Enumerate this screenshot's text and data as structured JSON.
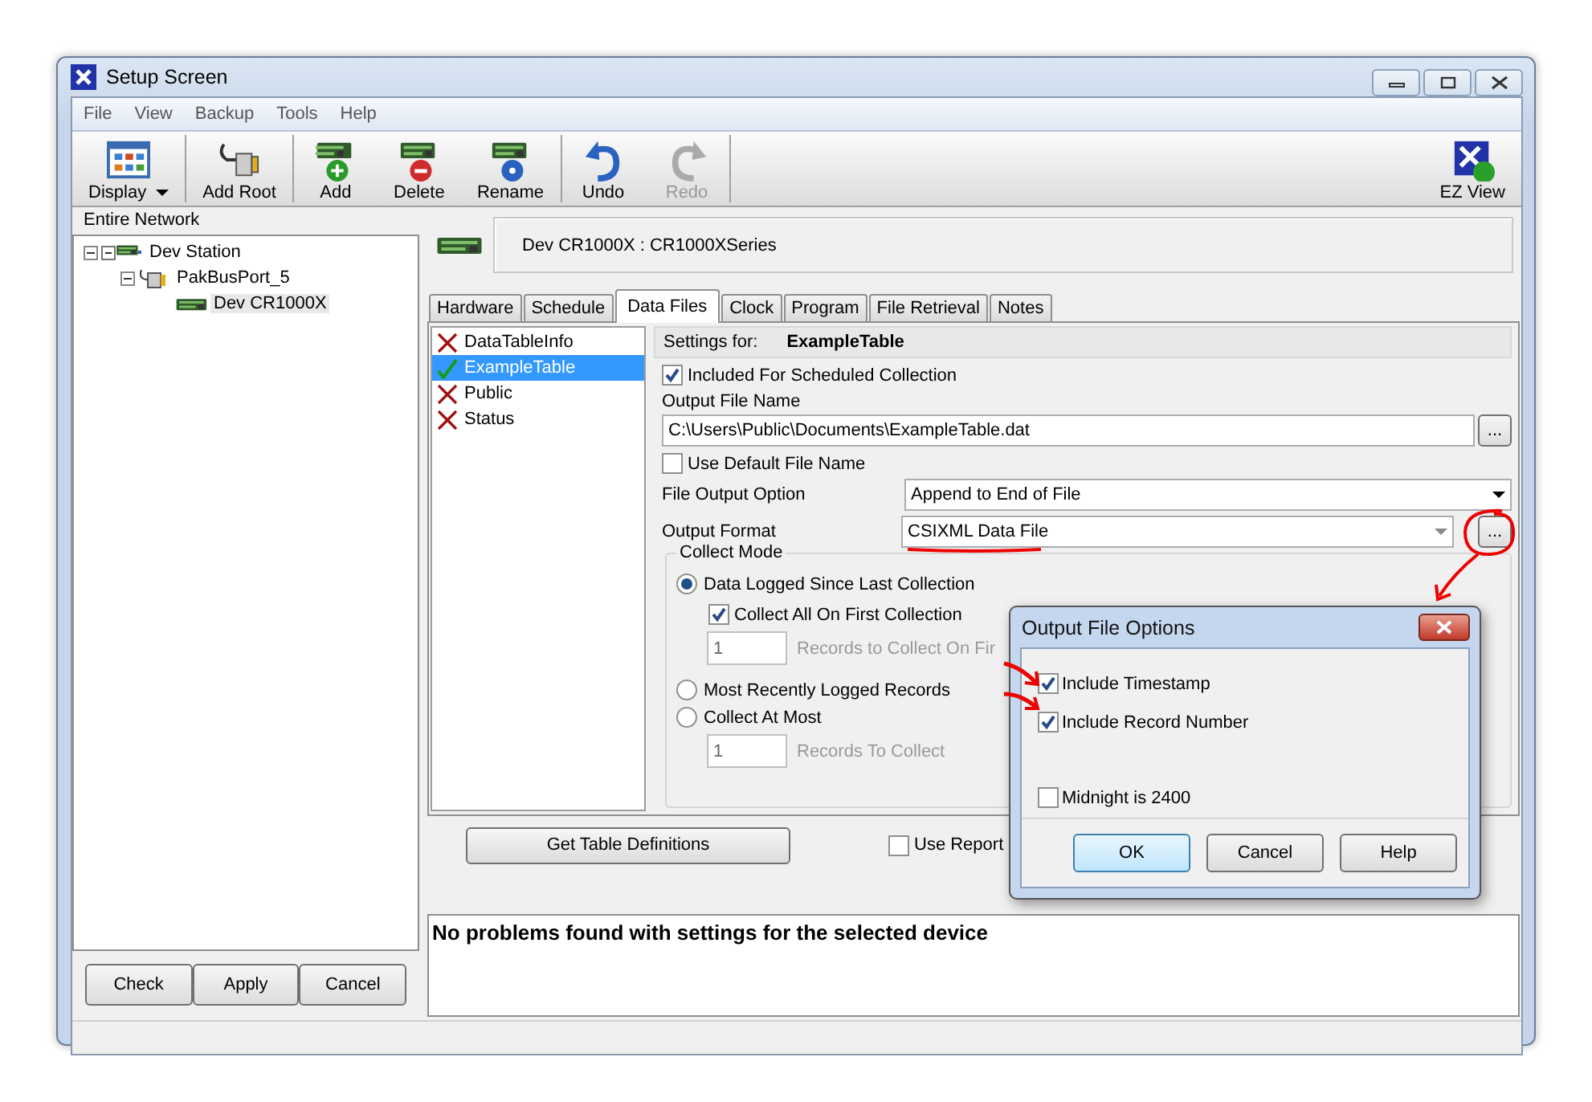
{
  "window": {
    "title": "Setup Screen"
  },
  "menu": [
    {
      "label": "File"
    },
    {
      "label": "View"
    },
    {
      "label": "Backup"
    },
    {
      "label": "Tools"
    },
    {
      "label": "Help"
    }
  ],
  "toolbar": [
    {
      "kind": "display",
      "label": "Display",
      "disabled": false,
      "separator_after": true
    },
    {
      "kind": "add_root",
      "label": "Add Root",
      "disabled": false,
      "separator_after": true
    },
    {
      "kind": "add",
      "label": "Add",
      "disabled": false,
      "separator_after": false
    },
    {
      "kind": "delete",
      "label": "Delete",
      "disabled": false,
      "separator_after": false
    },
    {
      "kind": "rename",
      "label": "Rename",
      "disabled": false,
      "separator_after": true
    },
    {
      "kind": "undo",
      "label": "Undo",
      "disabled": false,
      "separator_after": false
    },
    {
      "kind": "redo",
      "label": "Redo",
      "disabled": true,
      "separator_after": true
    },
    {
      "kind": "ez_view",
      "label": "EZ View",
      "disabled": false,
      "separator_after": false
    }
  ],
  "network": {
    "title": "Entire Network",
    "tree": [
      {
        "label": "Dev Station",
        "kind": "station",
        "expanded": true,
        "selected": false,
        "children": [
          {
            "label": "PakBusPort_5",
            "kind": "port",
            "expanded": true,
            "selected": false,
            "children": [
              {
                "label": "Dev CR1000X",
                "kind": "datalogger",
                "selected": true
              }
            ]
          }
        ]
      }
    ],
    "buttons": [
      {
        "label": "Check"
      },
      {
        "label": "Apply"
      },
      {
        "label": "Cancel"
      }
    ]
  },
  "device": {
    "title": "Dev CR1000X : CR1000XSeries"
  },
  "tabs": [
    {
      "label": "Hardware",
      "selected": false
    },
    {
      "label": "Schedule",
      "selected": false
    },
    {
      "label": "Data Files",
      "selected": true
    },
    {
      "label": "Clock",
      "selected": false
    },
    {
      "label": "Program",
      "selected": false
    },
    {
      "label": "File Retrieval",
      "selected": false
    },
    {
      "label": "Notes",
      "selected": false
    }
  ],
  "tables": [
    {
      "name": "DataTableInfo",
      "included": false,
      "selected": false
    },
    {
      "name": "ExampleTable",
      "included": true,
      "selected": true
    },
    {
      "name": "Public",
      "included": false,
      "selected": false
    },
    {
      "name": "Status",
      "included": false,
      "selected": false
    }
  ],
  "settings": {
    "settings_for_label": "Settings for:",
    "table_name": "ExampleTable",
    "included": {
      "label": "Included For Scheduled Collection",
      "checked": true
    },
    "output_file_name_label": "Output File Name",
    "output_file_name": "C:\\Users\\Public\\Documents\\ExampleTable.dat",
    "browse_button": "...",
    "use_default_name": {
      "label": "Use Default File Name",
      "checked": false
    },
    "file_output_option": {
      "label": "File Output Option",
      "value": "Append to End of File"
    },
    "output_format": {
      "label": "Output Format",
      "value": "CSIXML Data File",
      "button": "..."
    },
    "collect_mode": {
      "title": "Collect Mode",
      "data_logged": {
        "label": "Data Logged Since Last Collection",
        "selected": true
      },
      "collect_all": {
        "label": "Collect All On First Collection",
        "checked": true
      },
      "first_records": {
        "value": "1",
        "label": "Records to Collect On Fir",
        "disabled": true
      },
      "most_recent": {
        "label": "Most Recently Logged Records",
        "selected": false
      },
      "collect_at_most": {
        "label": "Collect At Most",
        "selected": false
      },
      "records_to_collect": {
        "value": "1",
        "label": "Records To Collect",
        "disabled": true
      }
    }
  },
  "get_table_definitions": "Get Table Definitions",
  "use_report": {
    "label": "Use Report",
    "checked": false
  },
  "message": "No problems found with settings for the selected device",
  "dialog": {
    "title": "Output File Options",
    "options": [
      {
        "label": "Include Timestamp",
        "checked": true
      },
      {
        "label": "Include Record Number",
        "checked": true
      },
      {
        "label": "Midnight is 2400",
        "checked": false
      }
    ],
    "buttons": [
      {
        "label": "OK",
        "default": true
      },
      {
        "label": "Cancel",
        "default": false
      },
      {
        "label": "Help",
        "default": false
      }
    ]
  }
}
